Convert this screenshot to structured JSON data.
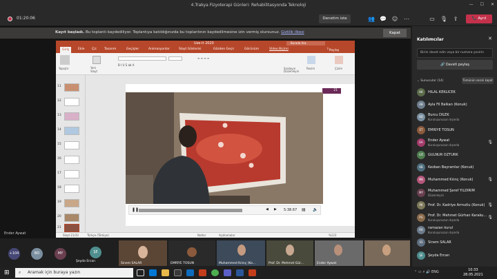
{
  "window": {
    "title": "4.Trakya Fizyoterapi Günleri: Rehabilitasyonda Teknoloji"
  },
  "meeting": {
    "timer": "01:20:06",
    "join_button": "Denetim iste",
    "leave_button": "Ayrıl",
    "leave_color": "#c4314b"
  },
  "banner": {
    "bold": "Kayıt başladı.",
    "text": "Bu toplantı kaydediliyor. Toplantıya katıldığınızda bu toplantının kaydedilmesine izin vermiş olursunuz.",
    "link": "Gizlilik ilkesi",
    "close": "Kapat"
  },
  "ppt": {
    "filename": "Use-it 2020",
    "search": "Burada Ara",
    "tabs": [
      "Giriş",
      "Ekle",
      "Çiz",
      "Tasarım",
      "Geçişler",
      "Animasyonlar",
      "Slayt Gösterisi",
      "Gözden Geçir",
      "Görünüm",
      "Video Biçimi"
    ],
    "share": "Paylaş",
    "ribbon": {
      "paste": "Yapıştır",
      "new_slide": "Yeni Slayt",
      "arrange": "Sıralayın",
      "quick_styles": "Düzenleyin",
      "picture": "Resim",
      "draw": "Çizim"
    },
    "thumbs": [
      "11",
      "12",
      "13",
      "14",
      "15",
      "16",
      "17",
      "18",
      "19",
      "20",
      "21"
    ],
    "slide_number": "21",
    "video_time": "5:38.67",
    "status": {
      "slide": "Slayt 21/33",
      "lang": "Türkçe (Türkiye)",
      "notes": "Notlar",
      "comments": "Açıklamalar",
      "zoom": "%123"
    }
  },
  "presenter": "Ender Aywat",
  "side": {
    "title": "Katılımcılar",
    "invite_placeholder": "Birini davet edin veya bir numara çevirin",
    "share_invite": "Daveti paylaş",
    "section": "Sunucular (14)",
    "mute_all": "Tümünün sesini kapat",
    "people": [
      {
        "initials": "HK",
        "name": "HİLAL KEKLİCEK",
        "sub": "",
        "color": "#5b6b4a",
        "mic": false
      },
      {
        "initials": "AB",
        "name": "Ayla Fil Balkan (Konuk)",
        "sub": "",
        "color": "#6e7e8e",
        "mic": false
      },
      {
        "initials": "BD",
        "name": "Burcu DİLEK",
        "sub": "Kuruluşunuzun dışında",
        "color": "#7a8fa0",
        "mic": false
      },
      {
        "initials": "ET",
        "name": "EMRİYE TOSUN",
        "sub": "",
        "color": "#8b5a3c",
        "mic": false
      },
      {
        "initials": "EA",
        "name": "Ender Aywat",
        "sub": "Kuruluşunuzun dışında",
        "color": "#a33b6a",
        "mic": true
      },
      {
        "initials": "GÖ",
        "name": "GÜLNUR ÖZTÜRK",
        "sub": "",
        "color": "#4f7e4f",
        "mic": false
      },
      {
        "initials": "KB",
        "name": "Kezban Bayramlar (Konuk)",
        "sub": "",
        "color": "#4f6e7e",
        "mic": false
      },
      {
        "initials": "MK",
        "name": "Muhammed Kılınç (Konuk)",
        "sub": "",
        "color": "#b4567a",
        "mic": true
      },
      {
        "initials": "MY",
        "name": "Muhammed Şeref YILDIRIM",
        "sub": "Düzenleyici",
        "color": "#6a3f4f",
        "mic": false
      },
      {
        "initials": "PK",
        "name": "Prof. Dr. Kadriye Armutlu (Konuk)",
        "sub": "",
        "color": "#7e7a5a",
        "mic": true
      },
      {
        "initials": "PG",
        "name": "Prof. Dr. Mehmet Gürhan Karaku...",
        "sub": "Kuruluşunuzun dışında",
        "color": "#8a6a4a",
        "mic": true
      },
      {
        "initials": "RK",
        "name": "ramazan kurul",
        "sub": "Kuruluşunuzun dışında",
        "color": "#6b7b8b",
        "mic": false
      },
      {
        "initials": "SS",
        "name": "Sinem SALAR",
        "sub": "",
        "color": "#5e6e80",
        "mic": false
      },
      {
        "initials": "ŞE",
        "name": "Şeyda Ercan",
        "sub": "",
        "color": "#4f8e8e",
        "mic": false
      }
    ]
  },
  "strip": {
    "overflow": "+104",
    "circles": [
      {
        "initials": "BD",
        "color": "#7a8fa0"
      },
      {
        "initials": "MY",
        "color": "#6a3f4f"
      },
      {
        "initials": "ŞE",
        "color": "#4f8e8e"
      }
    ],
    "first_name": "Şeyda Ercan",
    "tiles": [
      {
        "name": "Sinem SALAR"
      },
      {
        "name": "EMRİYE TOSUN"
      },
      {
        "name": "Muhammed Kılınç (Ko..."
      },
      {
        "name": "Prof. Dr. Mehmet Gür..."
      },
      {
        "name": "Ender Aywat"
      },
      {
        "name": ""
      }
    ]
  },
  "taskbar": {
    "search": "Aramak için buraya yazın",
    "time": "10:33",
    "date": "28.05.2021"
  }
}
